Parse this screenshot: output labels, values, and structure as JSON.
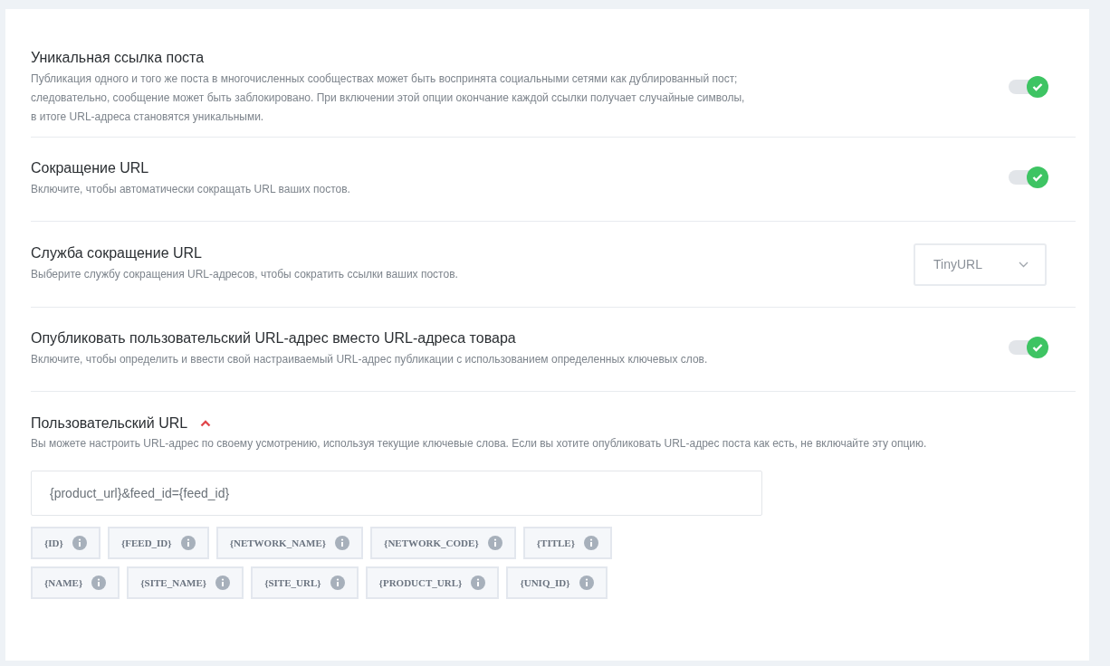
{
  "settings": [
    {
      "kind": "toggle",
      "title": "Уникальная ссылка поста",
      "description": "Публикация одного и того же поста в многочисленных сообществах может быть воспринята социальными сетями как дублированный пост;\nследовательно, сообщение может быть заблокировано. При включении этой опции окончание каждой ссылки получает случайные символы,\nв итоге URL-адреса становятся уникальными.",
      "on": true
    },
    {
      "kind": "toggle",
      "title": "Сокращение URL",
      "description": "Включите, чтобы автоматически сокращать URL ваших постов.",
      "on": true
    },
    {
      "kind": "select",
      "title": "Служба сокращение URL",
      "description": "Выберите службу сокращения URL-адресов, чтобы сократить ссылки ваших постов.",
      "value": "TinyURL"
    },
    {
      "kind": "toggle",
      "title": "Опубликовать пользовательский URL-адрес вместо URL-адреса товара",
      "description": "Включите, чтобы определить и ввести свой настраиваемый URL-адрес публикации с использованием определенных ключевых слов.",
      "on": true
    }
  ],
  "custom_url": {
    "title": "Пользовательский URL",
    "expanded": true,
    "description": "Вы можете настроить URL-адрес по своему усмотрению, используя текущие ключевые слова. Если вы хотите опубликовать URL-адрес поста как есть, не включайте эту опцию.",
    "value": "{product_url}&feed_id={feed_id}",
    "tag_rows": [
      [
        "{ID}",
        "{FEED_ID}",
        "{NETWORK_NAME}",
        "{NETWORK_CODE}",
        "{TITLE}"
      ],
      [
        "{NAME}",
        "{SITE_NAME}",
        "{SITE_URL}",
        "{PRODUCT_URL}",
        "{UNIQ_ID}"
      ]
    ]
  }
}
